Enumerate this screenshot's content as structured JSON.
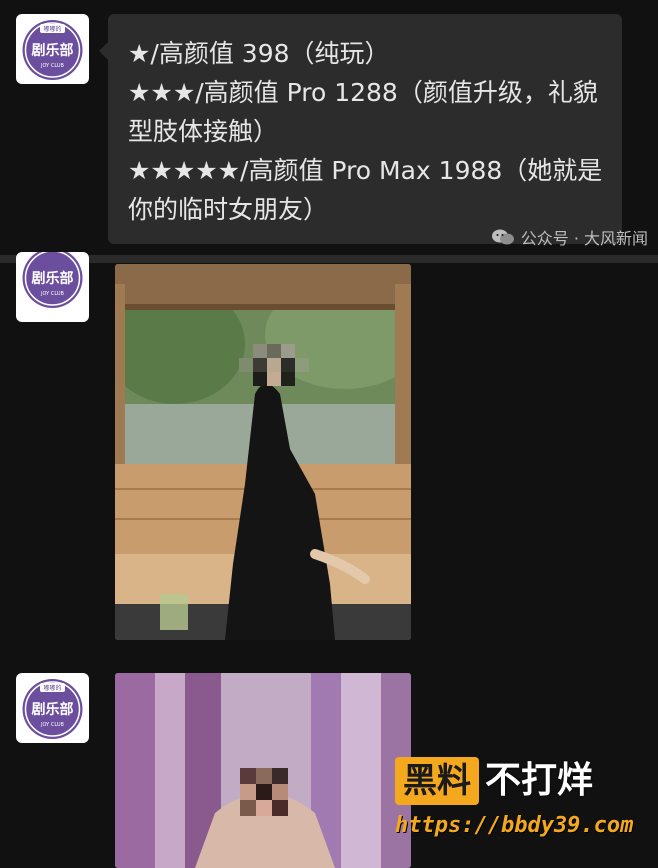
{
  "bubble": {
    "lines": [
      "★/高颜值 398（纯玩）",
      "★★★/高颜值 Pro 1288（颜值升级，礼貌型肢体接触）",
      "★★★★★/高颜值 Pro Max 1988（她就是你的临时女朋友）"
    ]
  },
  "avatar": {
    "top_text": "嘟嘟的",
    "main_text": "剧乐部",
    "sub_text": "JOY CLUB"
  },
  "watermark": {
    "text": "公众号 · 大风新闻",
    "icon": "wechat-icon"
  },
  "brand": {
    "box_text": "黑料",
    "word_text": "不打烊",
    "url": "https://bbdy39.com"
  },
  "colors": {
    "background": "#111111",
    "bubble": "#2c2c2c",
    "brand_orange": "#f4a81d",
    "avatar_purple": "#6b4f9e"
  }
}
